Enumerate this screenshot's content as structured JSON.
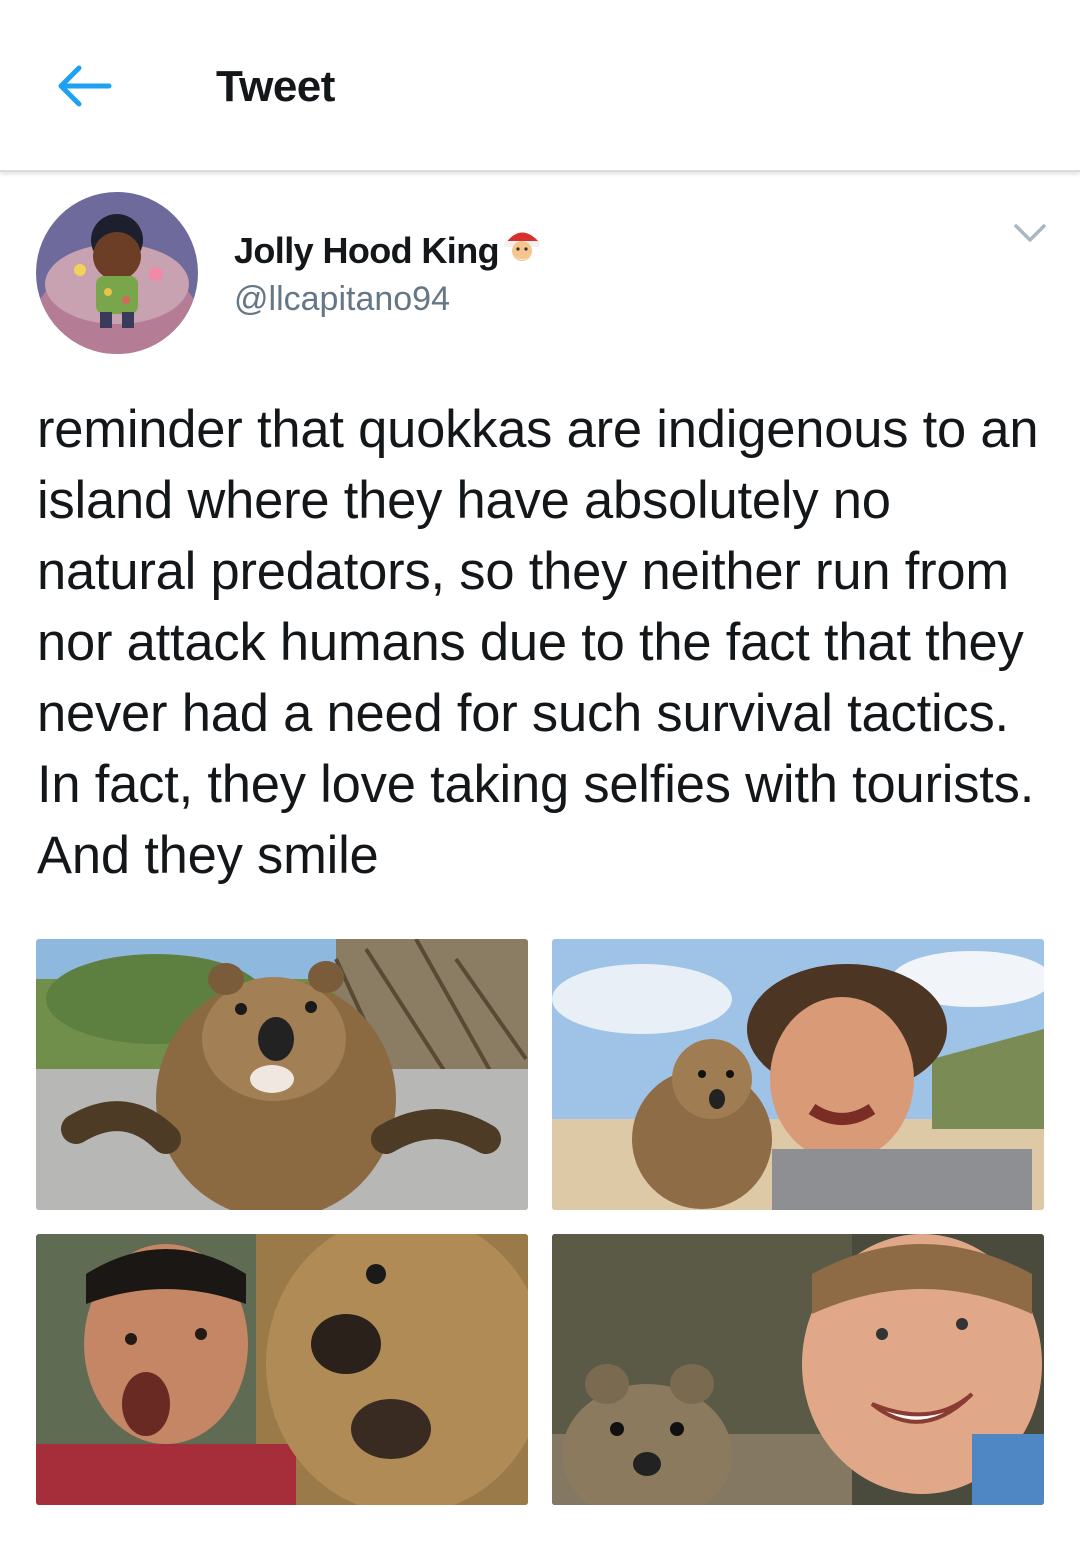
{
  "header": {
    "title": "Tweet",
    "back_icon": "arrow-left-icon",
    "accent": "#1da1f2"
  },
  "tweet": {
    "author_name": "Jolly Hood King",
    "author_emoji": "santa-emoji",
    "author_handle": "@llcapitano94",
    "text": "reminder that quokkas are indigenous to an island where they have absolutely no natural predators, so they neither run from nor attack humans due to the fact that they never had a need for such survival tactics. In fact, they love taking selfies with tourists. And they smile",
    "caret_icon": "chevron-down-icon",
    "media_count": 4
  }
}
